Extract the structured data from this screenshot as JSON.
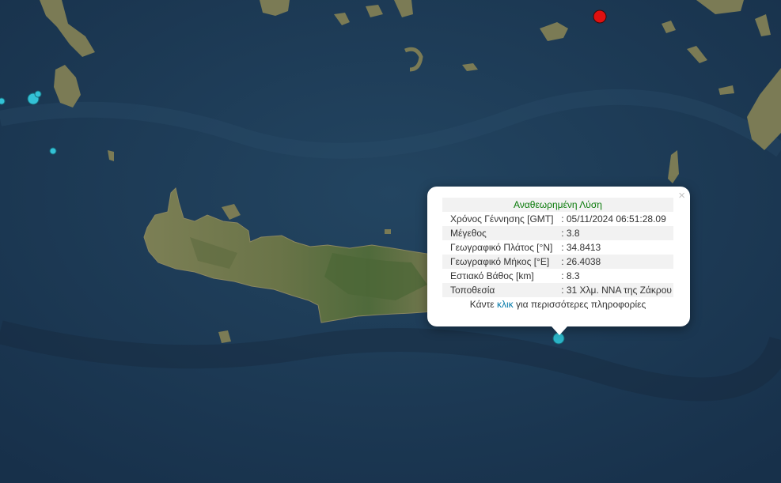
{
  "popup": {
    "header": "Αναθεωρημένη Λύση",
    "close_glyph": "×",
    "rows": [
      {
        "label": "Χρόνος Γέννησης [GMT]",
        "value": ": 05/11/2024 06:51:28.09"
      },
      {
        "label": "Μέγεθος",
        "value": ": 3.8"
      },
      {
        "label": "Γεωγραφικό Πλάτος [°N]",
        "value": ": 34.8413"
      },
      {
        "label": "Γεωγραφικό Μήκος [°E]",
        "value": ": 26.4038"
      },
      {
        "label": "Εστιακό Βάθος [km]",
        "value": ": 8.3"
      },
      {
        "label": "Τοποθεσία",
        "value": ": 31 Χλμ. ΝΝΑ της Ζάκρου"
      }
    ],
    "more_prefix": "Κάντε",
    "more_link": "κλικ",
    "more_suffix": "για περισσότερες πληροφορίες"
  },
  "markers": [
    {
      "name": "quake-red",
      "color": "#e01010"
    },
    {
      "name": "quake-selected",
      "color": "#2ab3c6"
    },
    {
      "name": "quake-cyan",
      "color": "#33c1d6"
    }
  ],
  "colors": {
    "sea": "#1d3b53",
    "land": "#6f7a4c",
    "land_green": "#566a3a"
  }
}
